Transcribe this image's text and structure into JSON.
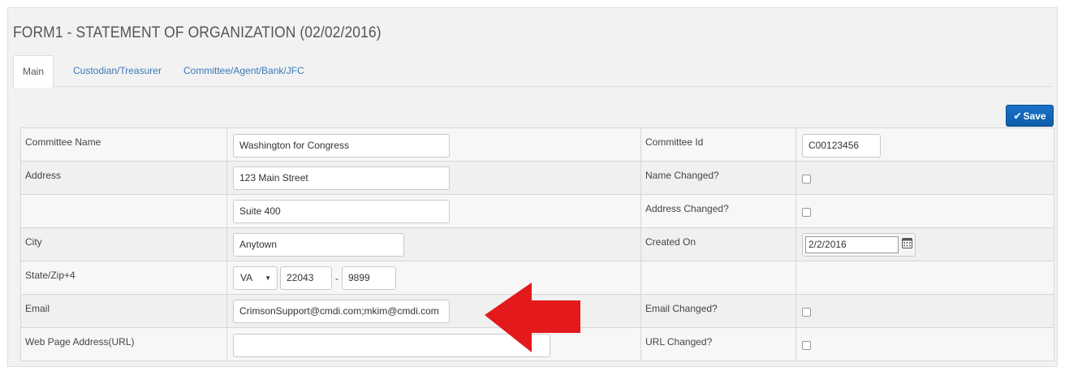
{
  "page": {
    "title": "FORM1 - STATEMENT OF ORGANIZATION (02/02/2016)"
  },
  "tabs": [
    {
      "label": "Main",
      "active": true
    },
    {
      "label": "Custodian/Treasurer",
      "active": false
    },
    {
      "label": "Committee/Agent/Bank/JFC",
      "active": false
    }
  ],
  "toolbar": {
    "save_label": "Save",
    "save_icon": "checkmark-icon"
  },
  "form": {
    "committee_name_label": "Committee Name",
    "committee_name_value": "Washington for Congress",
    "committee_id_label": "Committee Id",
    "committee_id_value": "C00123456",
    "address_label": "Address",
    "address_line1_value": "123 Main Street",
    "address_line2_value": "Suite 400",
    "name_changed_label": "Name Changed?",
    "address_changed_label": "Address Changed?",
    "city_label": "City",
    "city_value": "Anytown",
    "created_on_label": "Created On",
    "created_on_value": "2/2/2016",
    "state_zip_label": "State/Zip+4",
    "state_value": "VA",
    "zip_value": "22043",
    "zip4_value": "9899",
    "zip_separator": "-",
    "email_label": "Email",
    "email_value": "CrimsonSupport@cmdi.com;mkim@cmdi.com",
    "email_changed_label": "Email Changed?",
    "url_label": "Web Page Address(URL)",
    "url_value": "",
    "url_changed_label": "URL Changed?"
  },
  "annotation": {
    "arrow_color": "#e3191c",
    "arrow_direction": "left"
  },
  "colors": {
    "accent": "#1a73c9",
    "tab_link": "#3a78b8"
  }
}
